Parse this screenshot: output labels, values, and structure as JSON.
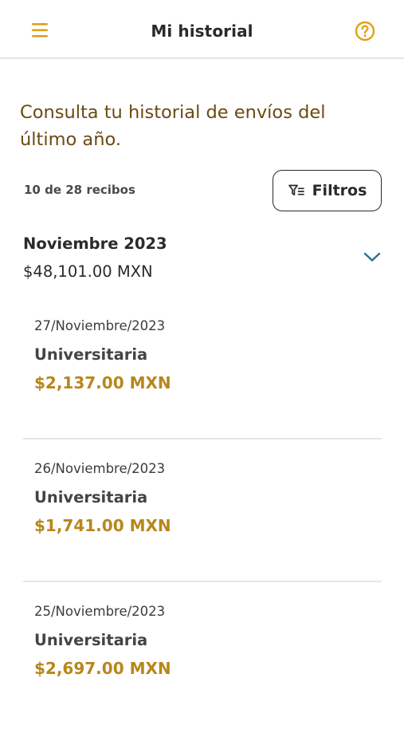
{
  "header": {
    "title": "Mi historial",
    "menu_icon": "hamburger-menu-icon",
    "help_icon": "help-circle-icon"
  },
  "intro": "Consulta tu historial de envíos del último año.",
  "count_text": "10 de 28 recibos",
  "filter": {
    "label": "Filtros",
    "icon": "filter-icon"
  },
  "month": {
    "title": "Noviembre 2023",
    "total": "$48,101.00 MXN",
    "expanded": true
  },
  "receipts": [
    {
      "date": "27/Noviembre/2023",
      "name": "Universitaria",
      "amount": "$2,137.00 MXN"
    },
    {
      "date": "26/Noviembre/2023",
      "name": "Universitaria",
      "amount": "$1,741.00 MXN"
    },
    {
      "date": "25/Noviembre/2023",
      "name": "Universitaria",
      "amount": "$2,697.00 MXN"
    }
  ],
  "colors": {
    "accent": "#e0a116",
    "amount": "#b8861b",
    "intro_text": "#6b4a12",
    "chevron": "#2f6f9a"
  }
}
